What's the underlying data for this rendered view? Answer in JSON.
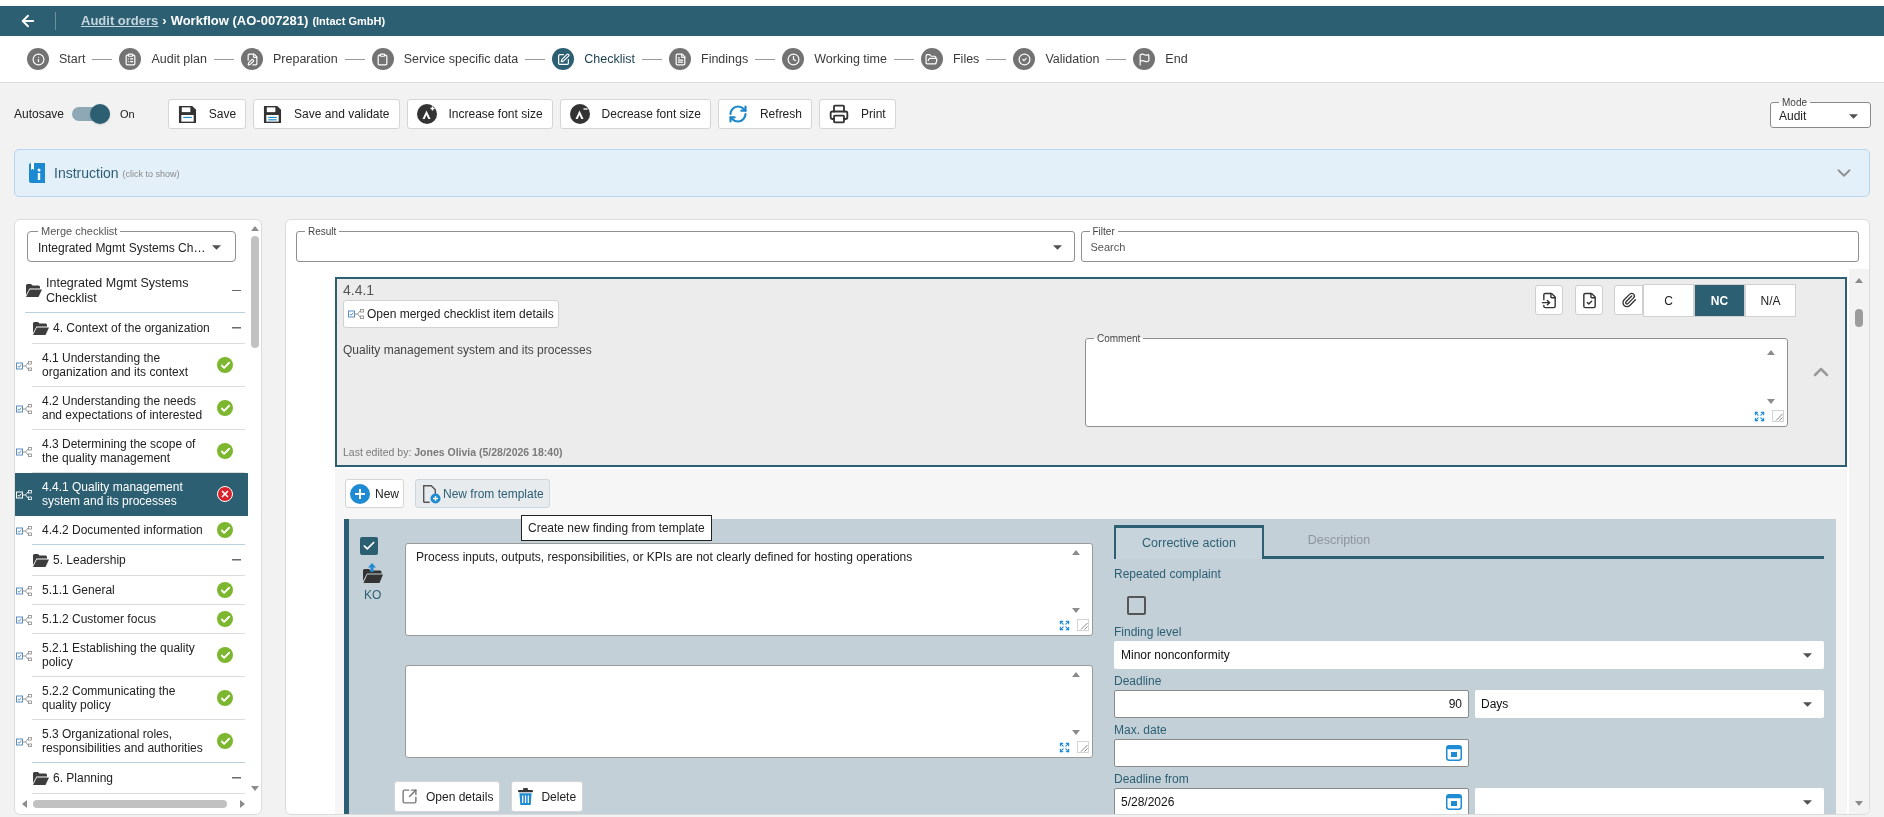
{
  "header": {
    "link": "Audit orders",
    "separator": "›",
    "title": "Workflow (AO-007281)",
    "customer": "(Intact GmbH)"
  },
  "steps": [
    {
      "label": "Start",
      "selected": false
    },
    {
      "label": "Audit plan",
      "selected": false
    },
    {
      "label": "Preparation",
      "selected": false
    },
    {
      "label": "Service specific data",
      "selected": false
    },
    {
      "label": "Checklist",
      "selected": true
    },
    {
      "label": "Findings",
      "selected": false
    },
    {
      "label": "Working time",
      "selected": false
    },
    {
      "label": "Files",
      "selected": false
    },
    {
      "label": "Validation",
      "selected": false
    },
    {
      "label": "End",
      "selected": false
    }
  ],
  "toolbar": {
    "autosave": {
      "label": "Autosave",
      "on": true,
      "state_label": "On"
    },
    "buttons": [
      {
        "kind": "save",
        "label": "Save"
      },
      {
        "kind": "save_validate",
        "label": "Save and validate"
      },
      {
        "kind": "font_up",
        "label": "Increase font size"
      },
      {
        "kind": "font_down",
        "label": "Decrease font size"
      },
      {
        "kind": "refresh",
        "label": "Refresh"
      },
      {
        "kind": "print",
        "label": "Print"
      }
    ],
    "mode": {
      "label": "Mode",
      "value": "Audit"
    }
  },
  "instruction": {
    "title": "Instruction",
    "hint": "(click to show)"
  },
  "sidebar": {
    "merge_checklist": {
      "label": "Merge checklist",
      "value": "Integrated Mgmt Systems Ch…"
    },
    "tree": [
      {
        "kind": "folder",
        "label": "Integrated Mgmt Systems Checklist",
        "expanded": true,
        "children": [
          {
            "kind": "folder",
            "label": "4. Context of the organization",
            "expanded": true,
            "children": [
              {
                "kind": "item",
                "label": "4.1 Understanding the organization and its context",
                "passed": true,
                "selected": false
              },
              {
                "kind": "item",
                "label": "4.2 Understanding the needs and expectations of interested",
                "passed": true,
                "selected": false
              },
              {
                "kind": "item",
                "label": "4.3 Determining the scope of the quality management",
                "passed": true,
                "selected": false
              },
              {
                "kind": "item",
                "label": "4.4.1 Quality management system and its processes",
                "passed": false,
                "selected": true
              },
              {
                "kind": "item",
                "label": "4.4.2 Documented information",
                "passed": true,
                "selected": false
              }
            ]
          },
          {
            "kind": "folder",
            "label": "5. Leadership",
            "expanded": true,
            "children": [
              {
                "kind": "item",
                "label": "5.1.1 General",
                "passed": true,
                "selected": false
              },
              {
                "kind": "item",
                "label": "5.1.2 Customer focus",
                "passed": true,
                "selected": false
              },
              {
                "kind": "item",
                "label": "5.2.1 Establishing the quality policy",
                "passed": true,
                "selected": false
              },
              {
                "kind": "item",
                "label": "5.2.2 Communicating the quality policy",
                "passed": true,
                "selected": false
              },
              {
                "kind": "item",
                "label": "5.3 Organizational roles, responsibilities and authorities",
                "passed": true,
                "selected": false
              }
            ]
          },
          {
            "kind": "folder",
            "label": "6. Planning",
            "expanded": true
          }
        ]
      }
    ]
  },
  "result_field": {
    "label": "Result"
  },
  "filter_field": {
    "label": "Filter",
    "placeholder": "Search"
  },
  "checklist_item": {
    "number": "4.4.1",
    "details_button": "Open merged checklist item details",
    "text": "Quality management system and its processes",
    "ratings": [
      {
        "label": "C",
        "selected": false
      },
      {
        "label": "NC",
        "selected": true
      },
      {
        "label": "N/A",
        "selected": false
      }
    ],
    "comment": {
      "label": "Comment"
    },
    "last_edited": "Last edited by: **Jones Olivia (5/28/2026 18:40)**"
  },
  "findings": {
    "buttons": [
      {
        "kind": "new",
        "label": "New"
      },
      {
        "kind": "template",
        "label": "New from template"
      }
    ],
    "tooltip": "Create new finding from template",
    "items": [
      {
        "checked": true,
        "tag": "KO",
        "text": "Process inputs, outputs, responsibilities, or KPIs are not clearly defined for hosting operations",
        "buttons": [
          {
            "kind": "open",
            "label": "Open details"
          },
          {
            "kind": "delete",
            "label": "Delete"
          }
        ],
        "tabs": [
          {
            "label": "Corrective action",
            "selected": true
          },
          {
            "label": "Description",
            "selected": false
          }
        ],
        "repeated_complaint": {
          "label": "Repeated complaint",
          "checked": false
        },
        "finding_level": {
          "label": "Finding level",
          "value": "Minor nonconformity"
        },
        "deadline": {
          "label": "Deadline",
          "value": "90",
          "unit": "Days"
        },
        "max_date": {
          "label": "Max. date"
        },
        "deadline_from": {
          "label": "Deadline from",
          "value": "5/28/2026"
        }
      }
    ]
  }
}
